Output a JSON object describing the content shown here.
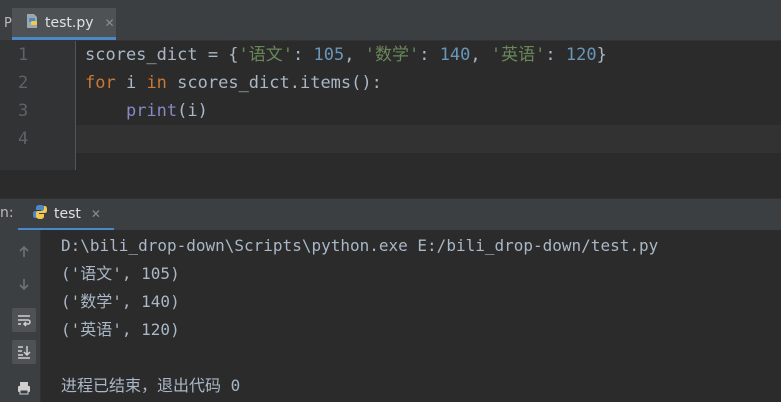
{
  "left_stub_text": "P",
  "editor_tab": {
    "file_name": "test.py",
    "close_glyph": "✕",
    "icon": "python-file-icon"
  },
  "editor": {
    "line_numbers": [
      "1",
      "2",
      "3",
      "4"
    ],
    "code": {
      "line1": {
        "var": "scores_dict",
        "op": " = {",
        "k1": "'语文'",
        "sep1": ": ",
        "v1": "105",
        "c1": ", ",
        "k2": "'数学'",
        "sep2": ": ",
        "v2": "140",
        "c2": ", ",
        "k3": "'英语'",
        "sep3": ": ",
        "v3": "120",
        "end": "}"
      },
      "line2": {
        "kw_for": "for",
        "mid1": " i ",
        "kw_in": "in",
        "rest": " scores_dict.items():"
      },
      "line3": {
        "indent": "    ",
        "fn": "print",
        "args": "(i)"
      }
    }
  },
  "run_window": {
    "stub_text": "n:",
    "tab_label": "test",
    "close_glyph": "✕",
    "console_lines": [
      "D:\\bili_drop-down\\Scripts\\python.exe E:/bili_drop-down/test.py",
      "('语文', 105)",
      "('数学', 140)",
      "('英语', 120)",
      "",
      "进程已结束，退出代码 0"
    ],
    "tools": [
      "up-arrow-icon",
      "down-arrow-icon",
      "soft-wrap-icon",
      "scroll-to-end-icon",
      "print-icon"
    ]
  },
  "colors": {
    "keyword": "#cc7832",
    "string": "#6a8759",
    "number": "#6897bb",
    "builtin": "#8888c6",
    "text": "#a9b7c6",
    "tab_underline": "#4a88c7"
  }
}
